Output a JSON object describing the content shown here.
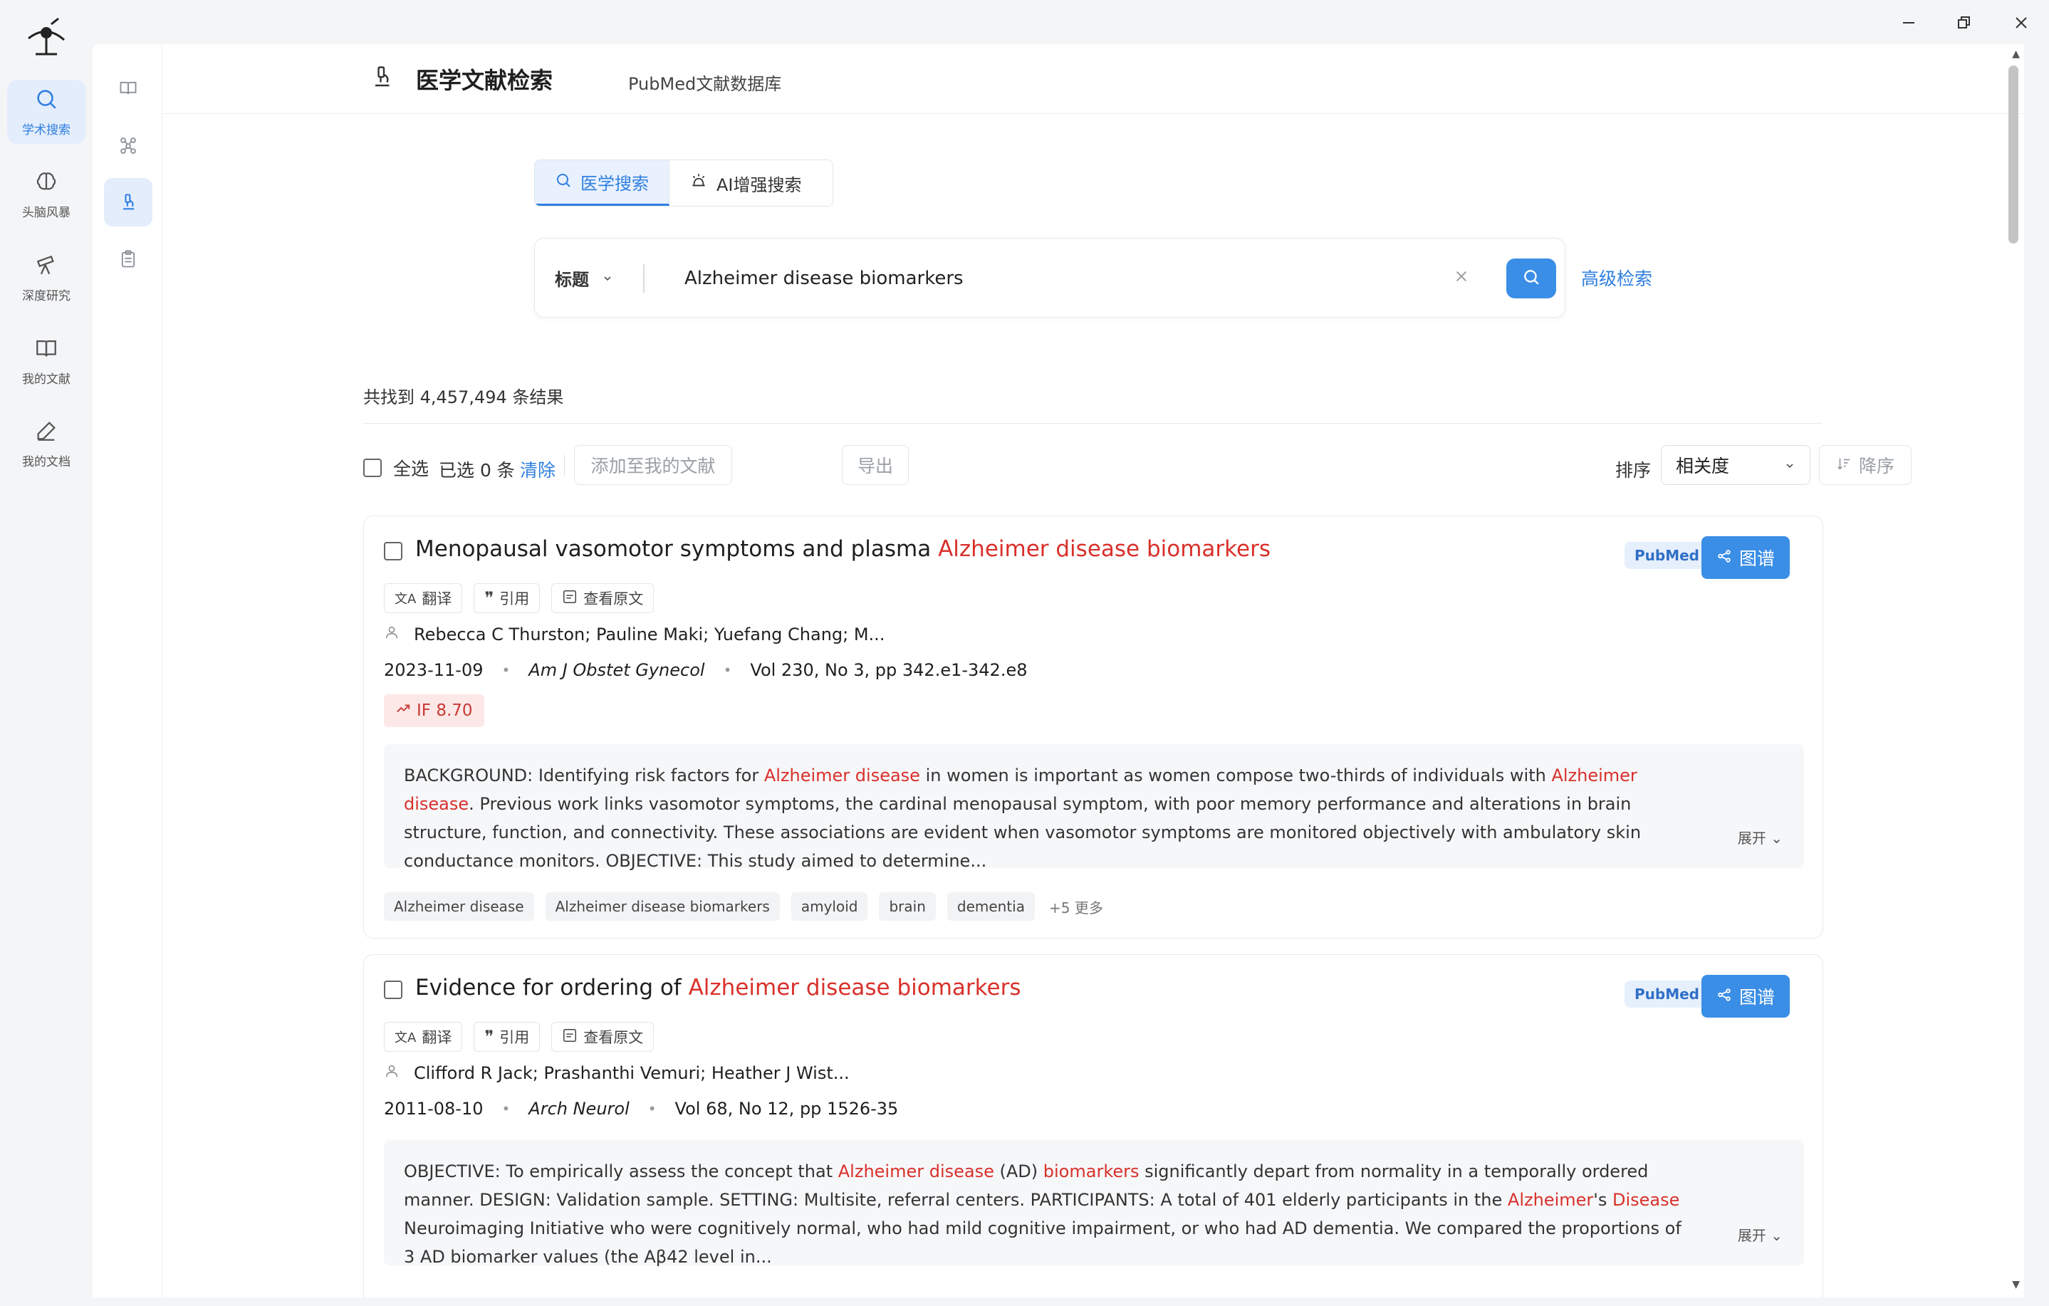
{
  "window": {
    "controls": [
      "minimize",
      "restore",
      "close"
    ]
  },
  "nav": {
    "items": [
      {
        "label": "学术搜索",
        "icon": "search-icon",
        "active": true
      },
      {
        "label": "头脑风暴",
        "icon": "brain-icon",
        "active": false
      },
      {
        "label": "深度研究",
        "icon": "telescope-icon",
        "active": false
      },
      {
        "label": "我的文献",
        "icon": "book-icon",
        "active": false
      },
      {
        "label": "我的文档",
        "icon": "pen-icon",
        "active": false
      }
    ]
  },
  "subnav": {
    "icons": [
      "open-book-icon",
      "graph-icon",
      "microscope-icon",
      "clipboard-icon"
    ],
    "active_index": 2
  },
  "header": {
    "title": "医学文献检索",
    "subtitle": "PubMed文献数据库"
  },
  "tabs": [
    {
      "label": "医学搜索",
      "active": true
    },
    {
      "label": "AI增强搜索",
      "active": false
    }
  ],
  "search": {
    "field": "标题",
    "query": "Alzheimer disease biomarkers",
    "advanced_label": "高级检索"
  },
  "results": {
    "count_text": "共找到 4,457,494 条结果"
  },
  "toolbar": {
    "select_all": "全选",
    "selected": "已选 0 条",
    "clear": "清除",
    "add_to_library": "添加至我的文献",
    "export": "导出",
    "sort_label": "排序",
    "sort_value": "相关度",
    "order": "降序"
  },
  "card_actions": {
    "translate": "翻译",
    "cite": "引用",
    "view_original": "查看原文",
    "graph": "图谱",
    "expand": "展开"
  },
  "articles": [
    {
      "title_plain": "Menopausal vasomotor symptoms and plasma ",
      "title_highlight": "Alzheimer disease biomarkers",
      "source": "PubMed",
      "authors": "Rebecca C Thurston; Pauline Maki; Yuefang Chang; M...",
      "date": "2023-11-09",
      "journal": "Am J Obstet Gynecol",
      "volume": "Vol 230, No 3, pp 342.e1-342.e8",
      "impact_factor": "IF 8.70",
      "abstract": [
        {
          "t": "BACKGROUND: Identifying risk factors for "
        },
        {
          "t": "Alzheimer disease",
          "hl": true
        },
        {
          "t": " in women is important as women compose two-thirds of individuals with "
        },
        {
          "t": "Alzheimer disease",
          "hl": true
        },
        {
          "t": ". Previous work links vasomotor symptoms, the cardinal menopausal symptom, with poor memory performance and alterations in brain structure, function, and connectivity. These associations are evident when vasomotor symptoms are monitored objectively with ambulatory skin conductance monitors. OBJECTIVE: This study aimed to determine..."
        }
      ],
      "tags": [
        "Alzheimer disease",
        "Alzheimer disease biomarkers",
        "amyloid",
        "brain",
        "dementia"
      ],
      "more_tags": "+5 更多"
    },
    {
      "title_plain": "Evidence for ordering of ",
      "title_highlight": "Alzheimer disease biomarkers",
      "source": "PubMed",
      "authors": "Clifford R Jack; Prashanthi Vemuri; Heather J Wist...",
      "date": "2011-08-10",
      "journal": "Arch Neurol",
      "volume": "Vol 68, No 12, pp 1526-35",
      "abstract": [
        {
          "t": "OBJECTIVE: To empirically assess the concept that "
        },
        {
          "t": "Alzheimer disease",
          "hl": true
        },
        {
          "t": " (AD) "
        },
        {
          "t": "biomarkers",
          "hl": true
        },
        {
          "t": " significantly depart from normality in a temporally ordered manner. DESIGN: Validation sample. SETTING: Multisite, referral centers. PARTICIPANTS: A total of 401 elderly participants in the "
        },
        {
          "t": "Alzheimer",
          "hl": true
        },
        {
          "t": "'s "
        },
        {
          "t": "Disease",
          "hl": true
        },
        {
          "t": " Neuroimaging Initiative who were cognitively normal, who had mild cognitive impairment, or who had AD dementia. We compared the proportions of 3 AD biomarker values (the Aβ42 level in..."
        }
      ]
    }
  ],
  "colors": {
    "accent": "#3a8ee6",
    "highlight": "#d9302b",
    "nav_active_bg": "#e3edfb"
  }
}
